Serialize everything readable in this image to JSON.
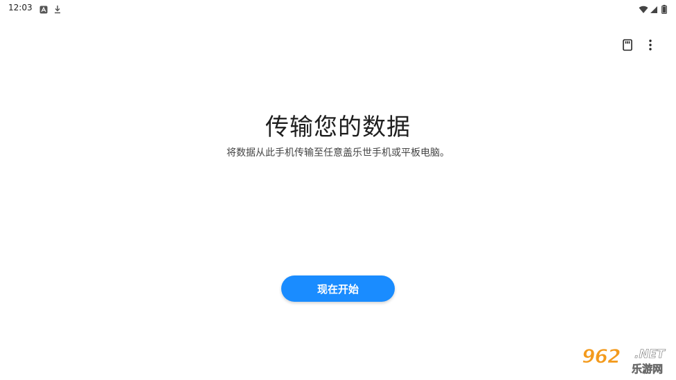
{
  "status_bar": {
    "time": "12:03",
    "left_icons": [
      "notification-a-icon",
      "download-icon"
    ],
    "right_icons": [
      "wifi-icon",
      "signal-icon",
      "battery-icon"
    ]
  },
  "toolbar": {
    "icons": [
      "sd-card-icon",
      "more-vert-icon"
    ]
  },
  "main": {
    "title": "传输您的数据",
    "subtitle": "将数据从此手机传输至任意盖乐世手机或平板电脑。",
    "start_button_label": "现在开始"
  },
  "watermark": {
    "number": "962",
    "suffix": ".NET",
    "chinese": "乐游网"
  },
  "colors": {
    "accent": "#1a8cff",
    "background": "#ffffff",
    "watermark_orange": "#f39a1c"
  }
}
